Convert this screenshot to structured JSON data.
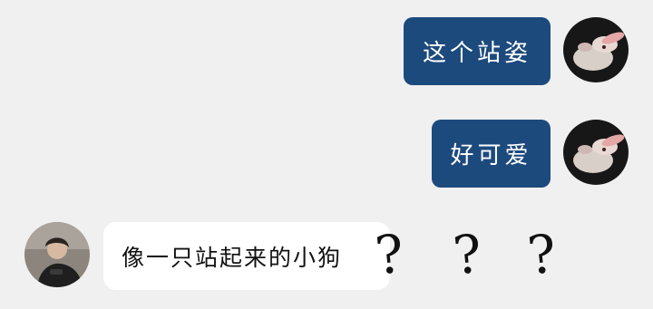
{
  "messages": [
    {
      "side": "right",
      "text": "这个站姿"
    },
    {
      "side": "right",
      "text": "好可爱"
    },
    {
      "side": "left",
      "text": "像一只站起来的小狗"
    }
  ],
  "reaction": {
    "marks": [
      "?",
      "?",
      "?"
    ]
  },
  "colors": {
    "background": "#f0f0f0",
    "outgoing_bubble": "#1d4a7d",
    "incoming_bubble": "#ffffff"
  },
  "icons": {
    "right_avatar": "rabbit-avatar-icon",
    "left_avatar": "person-avatar-icon"
  }
}
